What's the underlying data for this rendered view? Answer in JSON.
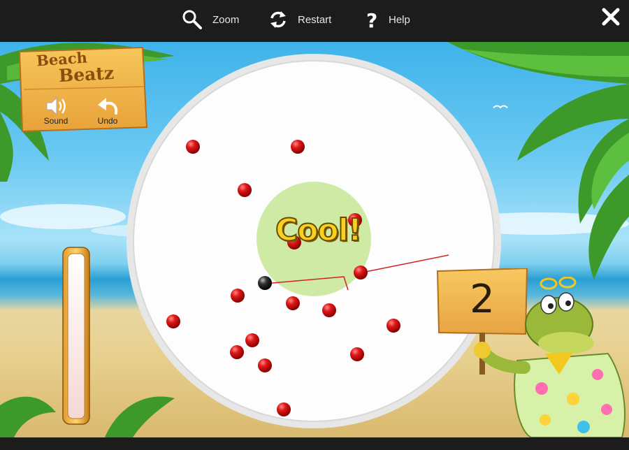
{
  "toolbar": {
    "zoom_label": "Zoom",
    "restart_label": "Restart",
    "help_label": "Help"
  },
  "game": {
    "title_line1": "Beach",
    "title_line2": "Beatz",
    "sound_label": "Sound",
    "undo_label": "Undo",
    "feedback": "Cool!",
    "score": "2",
    "power_level": 0
  },
  "colors": {
    "toolbar_bg": "#1c1c1c",
    "ball_red": "#d8141a",
    "cue_ball": "#1a1a1a",
    "target_zone": "#cfeaa4",
    "aim_line": "#d32020",
    "feedback_text": "#f7d11e"
  },
  "icons": {
    "zoom": "magnifier-icon",
    "restart": "restart-arrows-icon",
    "help": "question-mark-icon",
    "close": "close-x-icon",
    "sound": "speaker-icon",
    "undo": "undo-arrow-icon"
  }
}
